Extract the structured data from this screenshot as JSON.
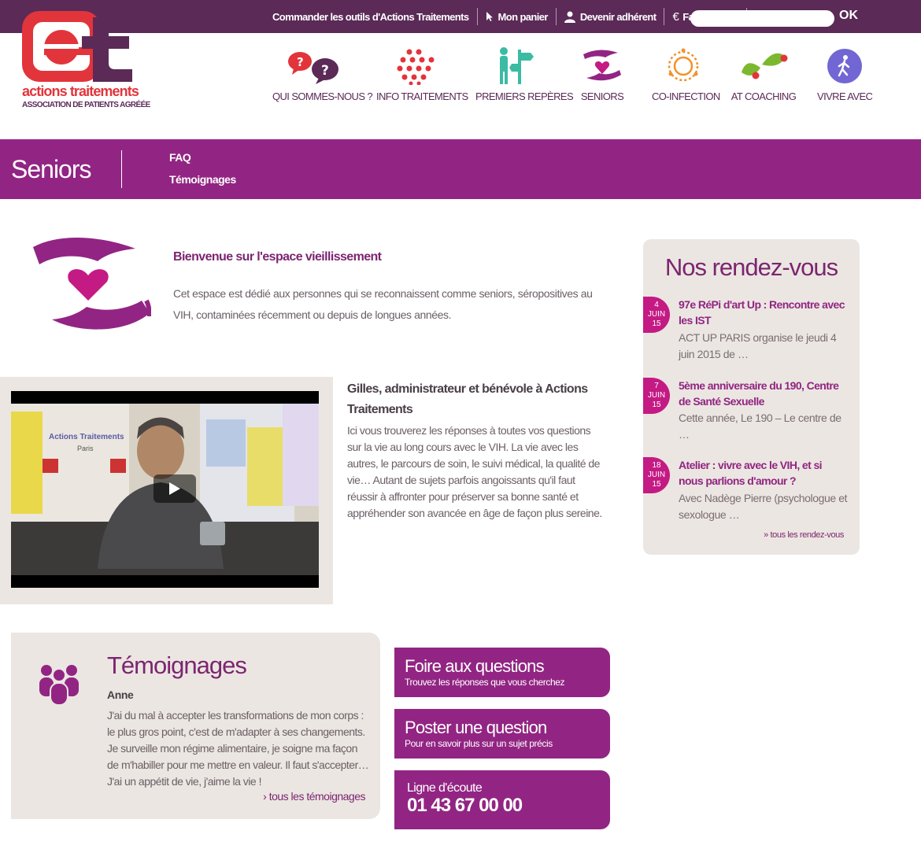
{
  "topbar": {
    "links": [
      "Commander les outils d'Actions Traitements",
      "Mon panier",
      "Devenir adhérent",
      "Faire un don"
    ],
    "search_placeholder": "",
    "search_button": "OK"
  },
  "logo": {
    "line1": "actions traitements",
    "line2": "ASSOCIATION DE PATIENTS AGRÉÉE"
  },
  "nav": [
    "QUI SOMMES-NOUS ?",
    "INFO TRAITEMENTS",
    "PREMIERS REPÈRES",
    "SENIORS",
    "CO-INFECTION",
    "AT COACHING",
    "VIVRE AVEC"
  ],
  "banner": {
    "title": "Seniors",
    "links": [
      "FAQ",
      "Témoignages"
    ]
  },
  "welcome": {
    "title": "Bienvenue sur l'espace vieillissement",
    "text": "Cet espace est dédié aux personnes qui se reconnaissent comme seniors, séropositives au VIH, contaminées récemment ou depuis de longues années."
  },
  "video": {
    "poster_text_1": "Actions Traitements",
    "poster_text_2": "Paris",
    "title": "Gilles, administrateur et bénévole à Actions Traitements",
    "text": "Ici vous trouverez les réponses à toutes vos questions sur la vie au long cours avec le VIH. La vie avec les autres, le parcours de soin, le suivi médical, la qualité de vie… Autant de sujets parfois angoissants qu'il faut réussir à affronter pour préserver sa bonne santé et appréhender son avancée en âge de façon plus sereine."
  },
  "agenda": {
    "title": "Nos rendez-vous",
    "events": [
      {
        "day": "4",
        "month": "JUIN",
        "year": "15",
        "title": "97e RéPi d'art Up : Rencontre avec les IST",
        "desc": "ACT UP PARIS organise le jeudi 4 juin 2015 de …"
      },
      {
        "day": "7",
        "month": "JUIN",
        "year": "15",
        "title": "5ème anniversaire du 190, Centre de Santé Sexuelle",
        "desc": "Cette année, Le 190 – Le centre de …"
      },
      {
        "day": "18",
        "month": "JUIN",
        "year": "15",
        "title": "Atelier : vivre avec le VIH, et si nous parlions d'amour ?",
        "desc": "Avec Nadège Pierre (psychologue et sexologue …"
      }
    ],
    "all_link": "» tous les rendez-vous"
  },
  "temoignages": {
    "title": "Témoignages",
    "name": "Anne",
    "quote": "J'ai du mal à accepter les transformations de mon corps : le plus gros point, c'est de m'adapter à ses changements. Je surveille mon régime alimentaire, je soigne ma façon de m'habiller pour me mettre en valeur. Il faut s'accepter… J'ai un appétit de vie, j'aime la vie !",
    "all_link": "› tous les témoignages"
  },
  "actions": [
    {
      "title": "Foire aux questions",
      "subtitle": "Trouvez les réponses que vous cherchez"
    },
    {
      "title": "Poster une question",
      "subtitle": "Pour en savoir plus sur un sujet précis"
    }
  ],
  "phone": {
    "label": "Ligne d'écoute",
    "number": "01 43 67 00 00"
  },
  "colors": {
    "topbar": "#5b2a57",
    "banner": "#922583",
    "panel": "#ebe6e1",
    "date_badge": "#c41a84",
    "logo_red": "#e2343b"
  }
}
